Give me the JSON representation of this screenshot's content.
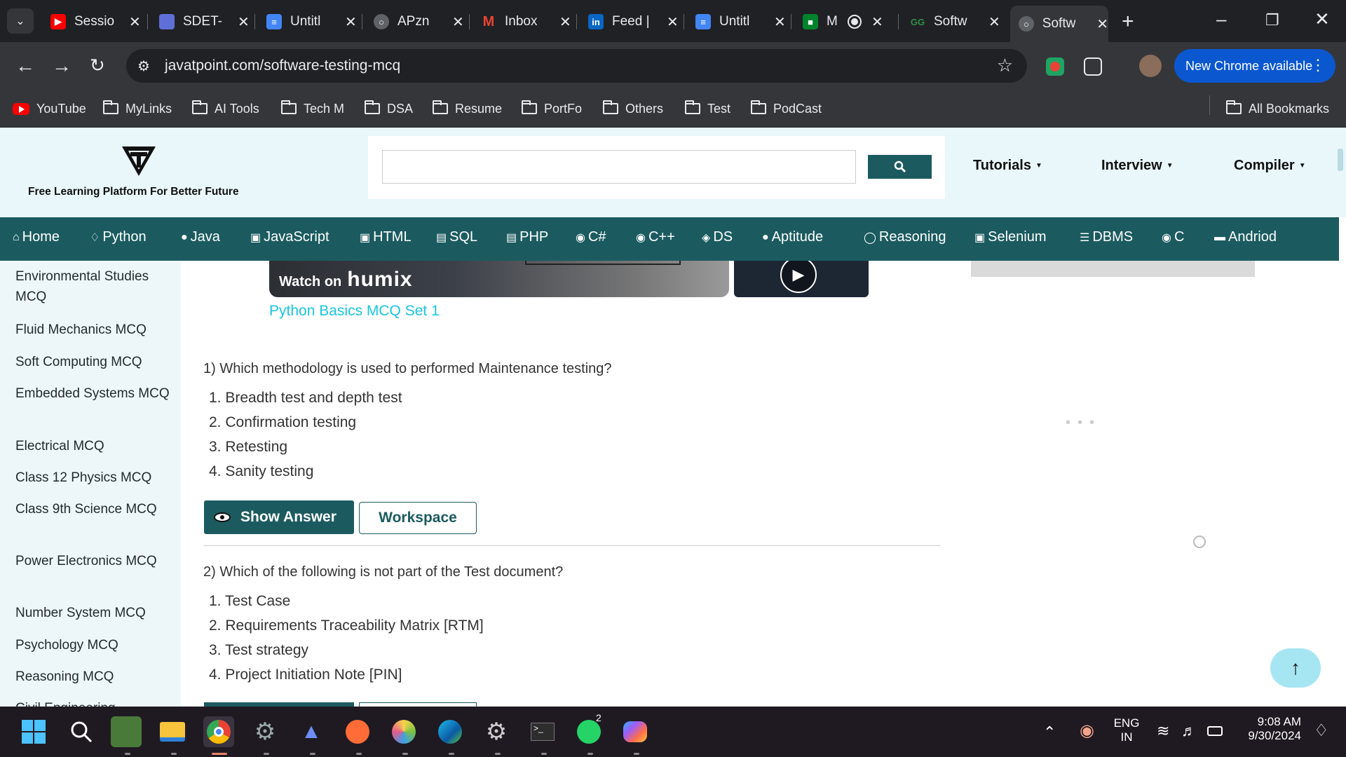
{
  "browser": {
    "tabs": [
      {
        "label": "Sessio",
        "favicon": "youtube"
      },
      {
        "label": "SDET-",
        "favicon": "doc"
      },
      {
        "label": "Untitl",
        "favicon": "gdocs"
      },
      {
        "label": "APzn",
        "favicon": "globe"
      },
      {
        "label": "Inbox",
        "favicon": "gmail"
      },
      {
        "label": "Feed |",
        "favicon": "linkedin"
      },
      {
        "label": "Untitl",
        "favicon": "gdocs"
      },
      {
        "label": "M",
        "favicon": "meet"
      },
      {
        "label": "Softw",
        "favicon": "gfg"
      },
      {
        "label": "Softw",
        "favicon": "globe"
      }
    ],
    "url": "javatpoint.com/software-testing-mcq",
    "new_chrome_label": "New Chrome available",
    "bookmarks": [
      "YouTube",
      "MyLinks",
      "AI Tools",
      "Tech M",
      "DSA",
      "Resume",
      "PortFo",
      "Others",
      "Test",
      "PodCast"
    ],
    "all_bookmarks": "All Bookmarks"
  },
  "site": {
    "tagline": "Free Learning Platform For Better Future",
    "top_nav": [
      "Tutorials",
      "Interview",
      "Compiler"
    ],
    "main_nav": [
      "Home",
      "Python",
      "Java",
      "JavaScript",
      "HTML",
      "SQL",
      "PHP",
      "C#",
      "C++",
      "DS",
      "Aptitude",
      "Reasoning",
      "Selenium",
      "DBMS",
      "C",
      "Andriod"
    ]
  },
  "sidebar": {
    "items": [
      "Environmental Studies MCQ",
      "Fluid Mechanics MCQ",
      "Soft Computing MCQ",
      "Embedded Systems MCQ",
      "Electrical MCQ",
      "Class 12 Physics MCQ",
      "Class 9th Science MCQ",
      "Power Electronics MCQ",
      "Number System MCQ",
      "Psychology MCQ",
      "Reasoning MCQ",
      "Civil Engineering"
    ]
  },
  "video": {
    "watch_on": "Watch on",
    "brand": "humix",
    "caption": "Python Basics MCQ Set 1"
  },
  "questions": [
    {
      "text": "1) Which methodology is used to performed Maintenance testing?",
      "options": [
        "1. Breadth test and depth test",
        "2. Confirmation testing",
        "3. Retesting",
        "4. Sanity testing"
      ]
    },
    {
      "text": "2) Which of the following is not part of the Test document?",
      "options": [
        "1. Test Case",
        "2. Requirements Traceability Matrix [RTM]",
        "3. Test strategy",
        "4. Project Initiation Note [PIN]"
      ]
    }
  ],
  "buttons": {
    "show_answer": "Show Answer",
    "workspace": "Workspace"
  },
  "taskbar": {
    "lang_top": "ENG",
    "lang_bottom": "IN",
    "time": "9:08 AM",
    "date": "9/30/2024",
    "whatsapp_badge": "2"
  },
  "colors": {
    "brand_teal": "#1b5b60",
    "header_bg": "#e9f7fb",
    "link_cyan": "#19c6e0"
  }
}
